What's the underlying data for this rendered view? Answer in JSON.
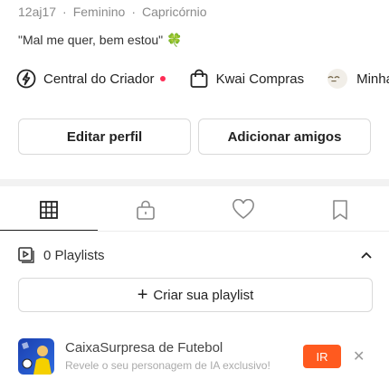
{
  "profile": {
    "meta": [
      "12aj17",
      "Feminino",
      "Capricórnio"
    ],
    "bio": "\"Mal me quer, bem estou\" 🍀"
  },
  "shortcuts": [
    {
      "label": "Central do Criador",
      "icon": "lightning-icon",
      "badge": true
    },
    {
      "label": "Kwai Compras",
      "icon": "shopping-bag-icon",
      "badge": false
    },
    {
      "label": "Minha",
      "icon": "emoji-face-icon",
      "badge": false
    }
  ],
  "actions": {
    "edit_profile": "Editar perfil",
    "add_friends": "Adicionar amigos"
  },
  "tabs": [
    {
      "name": "grid",
      "icon": "grid-icon",
      "active": true
    },
    {
      "name": "private",
      "icon": "lock-icon",
      "active": false
    },
    {
      "name": "likes",
      "icon": "heart-icon",
      "active": false
    },
    {
      "name": "saved",
      "icon": "bookmark-icon",
      "active": false
    }
  ],
  "playlists": {
    "label": "0 Playlists",
    "create_label": "Criar sua playlist"
  },
  "ad": {
    "title": "CaixaSurpresa de Futebol",
    "subtitle": "Revele o seu personagem de IA exclusivo!",
    "cta": "IR",
    "cta_color": "#ff5a1f"
  },
  "colors": {
    "badge": "#fe2c55",
    "accent": "#ff5a1f"
  }
}
